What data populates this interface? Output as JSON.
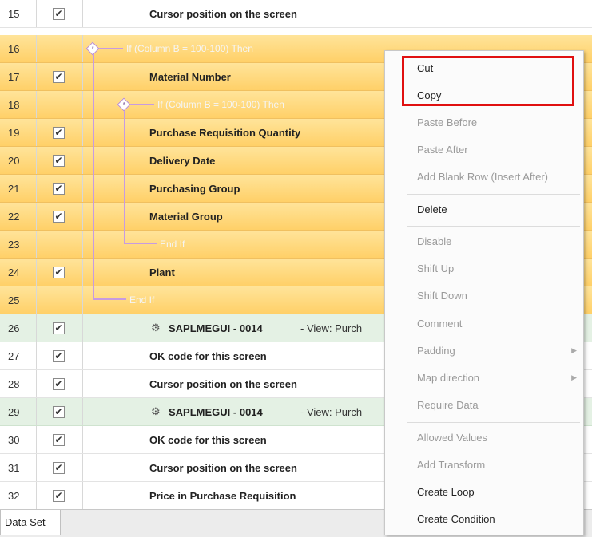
{
  "rows": [
    {
      "num": "15",
      "label": "Cursor position on the screen"
    },
    {
      "num": "16",
      "cond": "If (Column B = 100-100) Then"
    },
    {
      "num": "17",
      "label": "Material Number"
    },
    {
      "num": "18",
      "cond": "If (Column B = 100-100) Then"
    },
    {
      "num": "19",
      "label": "Purchase Requisition Quantity"
    },
    {
      "num": "20",
      "label": "Delivery Date"
    },
    {
      "num": "21",
      "label": "Purchasing Group"
    },
    {
      "num": "22",
      "label": "Material Group"
    },
    {
      "num": "23",
      "cond": "End If"
    },
    {
      "num": "24",
      "label": "Plant"
    },
    {
      "num": "25",
      "cond": "End If"
    },
    {
      "num": "26",
      "label": "SAPLMEGUI - 0014",
      "view": "-  View: Purch"
    },
    {
      "num": "27",
      "label": "OK code for this screen"
    },
    {
      "num": "28",
      "label": "Cursor position on the screen"
    },
    {
      "num": "29",
      "label": "SAPLMEGUI - 0014",
      "view": "-  View: Purch"
    },
    {
      "num": "30",
      "label": "OK code for this screen"
    },
    {
      "num": "31",
      "label": "Cursor position on the screen"
    },
    {
      "num": "32",
      "label": "Price in Purchase Requisition"
    }
  ],
  "tab": {
    "label": "Data Set"
  },
  "menu": {
    "cut": "Cut",
    "copy": "Copy",
    "paste_before": "Paste Before",
    "paste_after": "Paste After",
    "add_blank_row": "Add Blank Row (Insert After)",
    "delete": "Delete",
    "disable": "Disable",
    "shift_up": "Shift Up",
    "shift_down": "Shift Down",
    "comment": "Comment",
    "padding": "Padding",
    "map_direction": "Map direction",
    "require_data": "Require Data",
    "allowed_values": "Allowed Values",
    "add_transform": "Add Transform",
    "create_loop": "Create Loop",
    "create_condition": "Create Condition"
  },
  "icons": {
    "condition": "if-diamond-icon",
    "screen": "screen-gear-icon",
    "check": "check-icon",
    "submenu": "submenu-arrow-icon"
  },
  "colors": {
    "condition_row": "#ffd068",
    "screen_row": "#e4f1e4",
    "highlight": "#e01010"
  }
}
